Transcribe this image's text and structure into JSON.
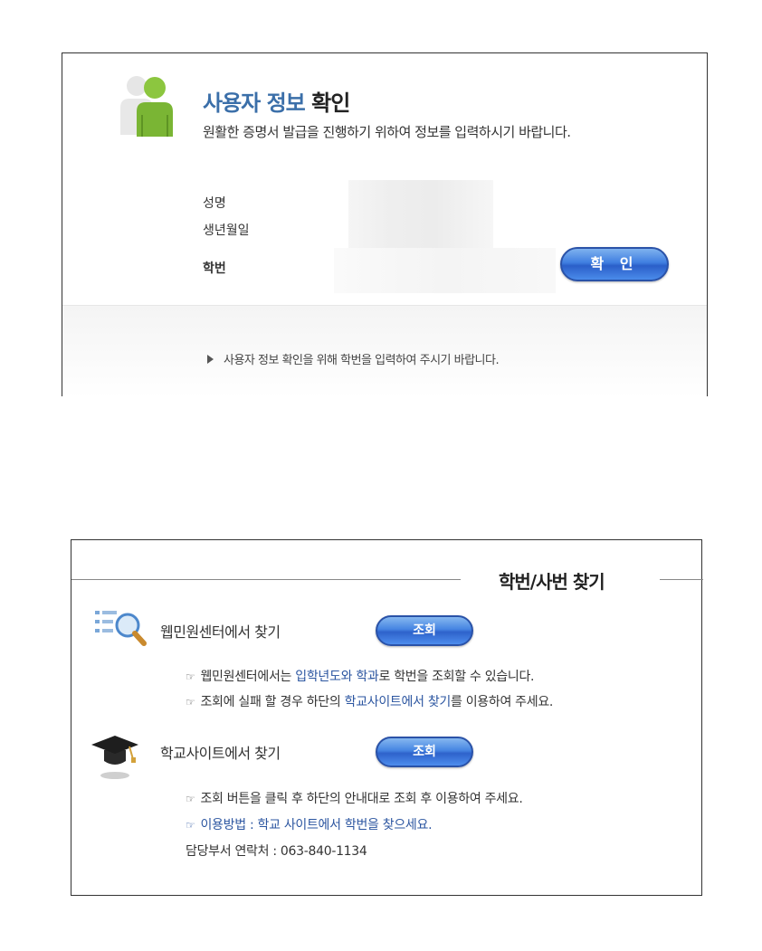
{
  "verify": {
    "title_blue": "사용자 정보",
    "title_dark": "확인",
    "subtitle": "원활한 증명서 발급을 진행하기 위하여 정보를 입력하시기 바랍니다.",
    "label_name": "성명",
    "label_birth": "생년월일",
    "label_student_no": "학번",
    "confirm_button": "확 인",
    "footer_note": "사용자 정보 확인을 위해 학번을 입력하여 주시기 바랍니다."
  },
  "find": {
    "title": "학번/사번 찾기",
    "webmin": {
      "title": "웹민원센터에서 찾기",
      "button": "조회",
      "bullet1_a": "웹민원센터에서는 ",
      "bullet1_hl": "입학년도와 학과",
      "bullet1_b": "로 학번을 조회할 수 있습니다.",
      "bullet2_a": "조회에 실패 할 경우 하단의 ",
      "bullet2_hl": "학교사이트에서 찾기",
      "bullet2_b": "를 이용하여 주세요."
    },
    "school": {
      "title": "학교사이트에서 찾기",
      "button": "조회",
      "bullet1": "조회 버튼을 클릭 후 하단의 안내대로 조회 후 이용하여 주세요.",
      "bullet2": "이용방법 : 학교 사이트에서 학번을 찾으세요.",
      "contact": "담당부서 연락처 : 063-840-1134"
    }
  },
  "icons": [
    "users-icon",
    "play-triangle-icon",
    "search-list-icon",
    "graduation-cap-icon",
    "pointing-hand-icon"
  ],
  "colors": {
    "accent_blue": "#3b6fa9",
    "button_blue": "#3f7ee0",
    "link_blue": "#2b55a0"
  }
}
